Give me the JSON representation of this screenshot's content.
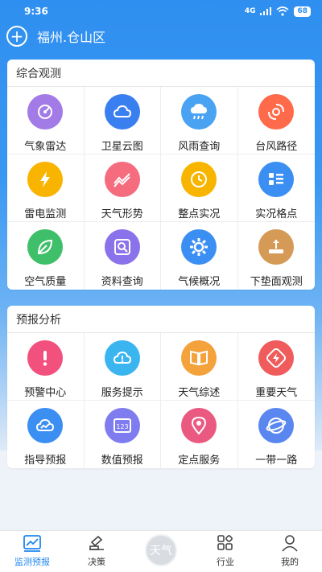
{
  "status": {
    "time": "9:36",
    "signal": "4G",
    "battery": "68"
  },
  "header": {
    "location": "福州.仓山区"
  },
  "sections": [
    {
      "title": "综合观测",
      "items": [
        {
          "label": "气象雷达",
          "icon": "radar-icon",
          "color": "#a27be6"
        },
        {
          "label": "卫星云图",
          "icon": "cloud-icon",
          "color": "#3a7ff0"
        },
        {
          "label": "风雨查询",
          "icon": "cloud-rain-icon",
          "color": "#4aa3f2"
        },
        {
          "label": "台风路径",
          "icon": "typhoon-icon",
          "color": "#ff6a4a"
        },
        {
          "label": "雷电监测",
          "icon": "lightning-icon",
          "color": "#f9b400"
        },
        {
          "label": "天气形势",
          "icon": "trend-icon",
          "color": "#f56c7f"
        },
        {
          "label": "整点实况",
          "icon": "clock-icon",
          "color": "#f8b500"
        },
        {
          "label": "实况格点",
          "icon": "grid-list-icon",
          "color": "#3b8ef2"
        },
        {
          "label": "空气质量",
          "icon": "leaf-icon",
          "color": "#3fbf6a"
        },
        {
          "label": "资料查询",
          "icon": "doc-search-icon",
          "color": "#8a72ea"
        },
        {
          "label": "气候概况",
          "icon": "gear-sun-icon",
          "color": "#3b8ef2"
        },
        {
          "label": "下垫面观测",
          "icon": "surface-icon",
          "color": "#d69a57"
        }
      ]
    },
    {
      "title": "预报分析",
      "items": [
        {
          "label": "预警中心",
          "icon": "alert-icon",
          "color": "#f2517e"
        },
        {
          "label": "服务提示",
          "icon": "cloud-alert-icon",
          "color": "#3bb5f0"
        },
        {
          "label": "天气综述",
          "icon": "book-icon",
          "color": "#f3a23c"
        },
        {
          "label": "重要天气",
          "icon": "bolt-box-icon",
          "color": "#f05b5b"
        },
        {
          "label": "指导预报",
          "icon": "cloud-graph-icon",
          "color": "#3b8ef2"
        },
        {
          "label": "数值预报",
          "icon": "numbers-icon",
          "color": "#7f7cf0"
        },
        {
          "label": "定点服务",
          "icon": "location-pin-icon",
          "color": "#ea5a80"
        },
        {
          "label": "一带一路",
          "icon": "globe-icon",
          "color": "#5a86f0"
        }
      ]
    }
  ],
  "tabbar": [
    {
      "label": "监测预报",
      "icon": "chart-tab-icon",
      "active": true
    },
    {
      "label": "决策",
      "icon": "decision-tab-icon",
      "active": false
    },
    {
      "label": "",
      "icon": "weather-center-icon",
      "center_text": "天气",
      "active": false
    },
    {
      "label": "行业",
      "icon": "industry-tab-icon",
      "active": false
    },
    {
      "label": "我的",
      "icon": "user-tab-icon",
      "active": false
    }
  ]
}
